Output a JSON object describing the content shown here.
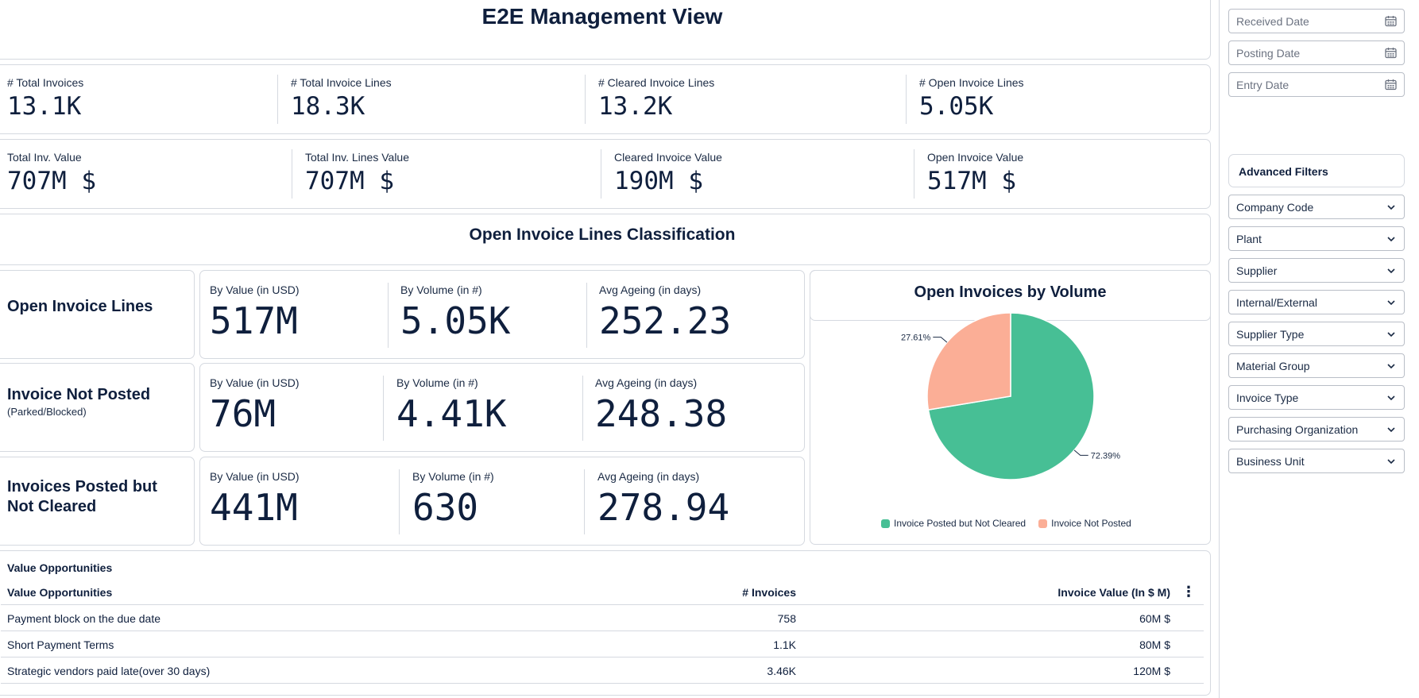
{
  "header": {
    "title": "E2E Management View"
  },
  "kpis_row1": [
    {
      "label": "# Total Invoices",
      "value": "13.1K"
    },
    {
      "label": "# Total Invoice Lines",
      "value": "18.3K"
    },
    {
      "label": "# Cleared Invoice Lines",
      "value": "13.2K"
    },
    {
      "label": "# Open Invoice Lines",
      "value": "5.05K"
    }
  ],
  "kpis_row2": [
    {
      "label": "Total Inv. Value",
      "value": "707M $"
    },
    {
      "label": "Total Inv. Lines Value",
      "value": "707M $"
    },
    {
      "label": "Cleared Invoice Value",
      "value": "190M $"
    },
    {
      "label": "Open Invoice Value",
      "value": "517M $"
    }
  ],
  "classification": {
    "title": "Open Invoice Lines Classification",
    "rows": [
      {
        "label": "Open Invoice Lines",
        "sublabel": "",
        "by_value_label": "By Value (in USD)",
        "by_value": "517M",
        "by_volume_label": "By Volume (in #)",
        "by_volume": "5.05K",
        "ageing_label": "Avg Ageing (in days)",
        "ageing": "252.23"
      },
      {
        "label": "Invoice Not Posted",
        "sublabel": "(Parked/Blocked)",
        "by_value_label": "By Value (in USD)",
        "by_value": "76M",
        "by_volume_label": "By Volume (in #)",
        "by_volume": "4.41K",
        "ageing_label": "Avg Ageing (in days)",
        "ageing": "248.38"
      },
      {
        "label_line1": "Invoices Posted but",
        "label_line2": "Not Cleared",
        "by_value_label": "By Value (in USD)",
        "by_value": "441M",
        "by_volume_label": "By Volume (in #)",
        "by_volume": "630",
        "ageing_label": "Avg Ageing (in days)",
        "ageing": "278.94"
      }
    ]
  },
  "chart_data": {
    "type": "pie",
    "title": "Open Invoices by Volume",
    "slices": [
      {
        "name": "Invoice Posted but Not Cleared",
        "value": 72.39,
        "label": "72.39%",
        "color": "#47bf95"
      },
      {
        "name": "Invoice Not Posted",
        "value": 27.61,
        "label": "27.61%",
        "color": "#fbae96"
      }
    ],
    "legend_position": "bottom"
  },
  "value_opportunities": {
    "caption": "Value Opportunities",
    "columns": [
      "Value Opportunities",
      "# Invoices",
      "Invoice Value (In $ M)"
    ],
    "rows": [
      [
        "Payment block on the due date",
        "758",
        "60M $"
      ],
      [
        "Short Payment Terms",
        "1.1K",
        "80M $"
      ],
      [
        "Strategic vendors paid late(over 30 days)",
        "3.46K",
        "120M $"
      ]
    ],
    "menu_icon": "more-vertical-icon"
  },
  "date_filters": [
    {
      "placeholder": "Received Date"
    },
    {
      "placeholder": "Posting Date"
    },
    {
      "placeholder": "Entry Date"
    }
  ],
  "advanced_filters": {
    "title": "Advanced Filters",
    "items": [
      "Company Code",
      "Plant",
      "Supplier",
      "Internal/External",
      "Supplier Type",
      "Material Group",
      "Invoice Type",
      "Purchasing Organization",
      "Business Unit"
    ]
  }
}
